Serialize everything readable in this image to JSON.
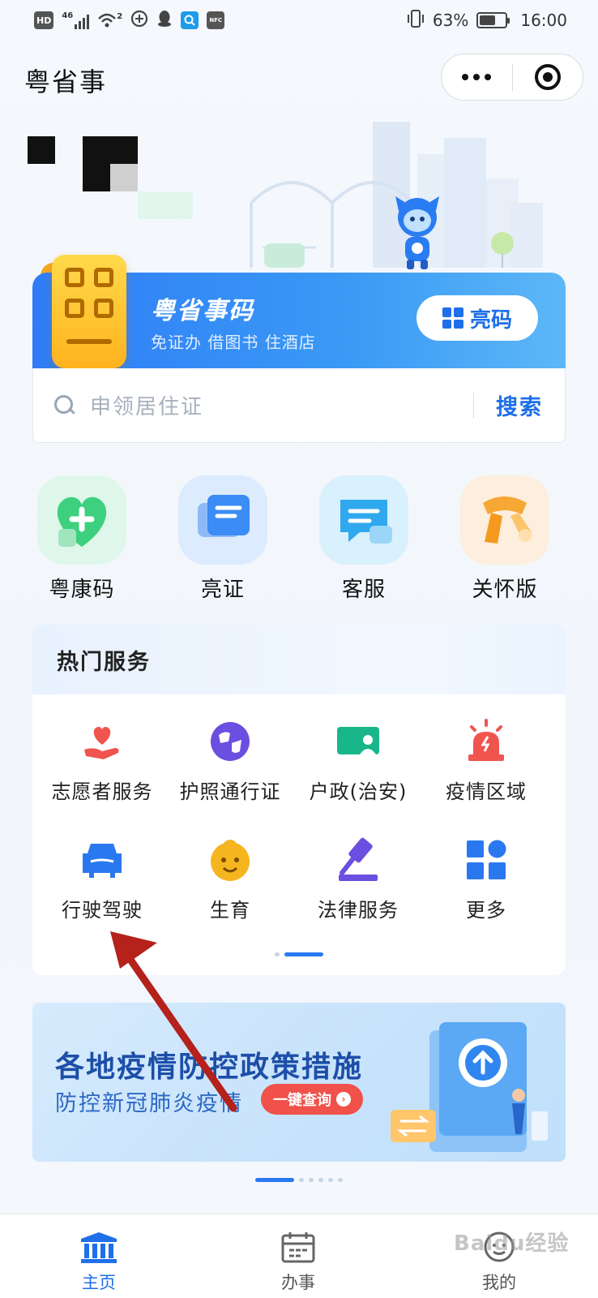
{
  "status_bar": {
    "network_badge": "HD",
    "signal_label": "46",
    "wifi_label": "2",
    "nfc_label": "NFC",
    "battery_percent": 63,
    "battery_text": "63%",
    "time": "16:00"
  },
  "header": {
    "app_title": "粤省事",
    "more_icon": "more-dots-icon",
    "close_icon": "target-circle-icon"
  },
  "code_card": {
    "title": "粤省事码",
    "subtitle": "免证办 借图书 住酒店",
    "button_label": "亮码"
  },
  "search": {
    "placeholder": "申领居住证",
    "button_label": "搜索"
  },
  "quick_entries": [
    {
      "label": "粤康码",
      "icon": "health-heart-icon",
      "color": "#3dd07f"
    },
    {
      "label": "亮证",
      "icon": "id-card-icon",
      "color": "#3b8cf5"
    },
    {
      "label": "客服",
      "icon": "chat-bubble-icon",
      "color": "#2fa8ee"
    },
    {
      "label": "关怀版",
      "icon": "scarf-icon",
      "color": "#f7a733"
    }
  ],
  "hot_services": {
    "title": "热门服务",
    "items": [
      {
        "label": "志愿者服务",
        "icon": "volunteer-heart-hand-icon",
        "color": "#f0544f"
      },
      {
        "label": "护照通行证",
        "icon": "passport-globe-icon",
        "color": "#6a4fe0"
      },
      {
        "label": "户政(治安)",
        "icon": "household-card-icon",
        "color": "#19b68a"
      },
      {
        "label": "疫情区域",
        "icon": "alarm-siren-icon",
        "color": "#f0544f"
      },
      {
        "label": "行驶驾驶",
        "icon": "car-icon",
        "color": "#2a78f0"
      },
      {
        "label": "生育",
        "icon": "baby-face-icon",
        "color": "#f5b51e"
      },
      {
        "label": "法律服务",
        "icon": "gavel-icon",
        "color": "#6a4fe0"
      },
      {
        "label": "更多",
        "icon": "more-grid-icon",
        "color": "#2a78f0"
      }
    ],
    "page_index": 2,
    "page_count": 2
  },
  "banner": {
    "title": "各地疫情防控政策措施",
    "subtitle": "防控新冠肺炎疫情",
    "button_label": "一键查询",
    "page_index": 1,
    "page_count": 5
  },
  "tab_bar": {
    "tabs": [
      {
        "label": "主页",
        "icon": "home-building-icon",
        "active": true
      },
      {
        "label": "办事",
        "icon": "calendar-icon",
        "active": false
      },
      {
        "label": "我的",
        "icon": "profile-face-icon",
        "active": false
      }
    ]
  },
  "watermark": "Baidu经验",
  "colors": {
    "accent": "#1e6fe8",
    "annotation_arrow": "#b5211b"
  }
}
